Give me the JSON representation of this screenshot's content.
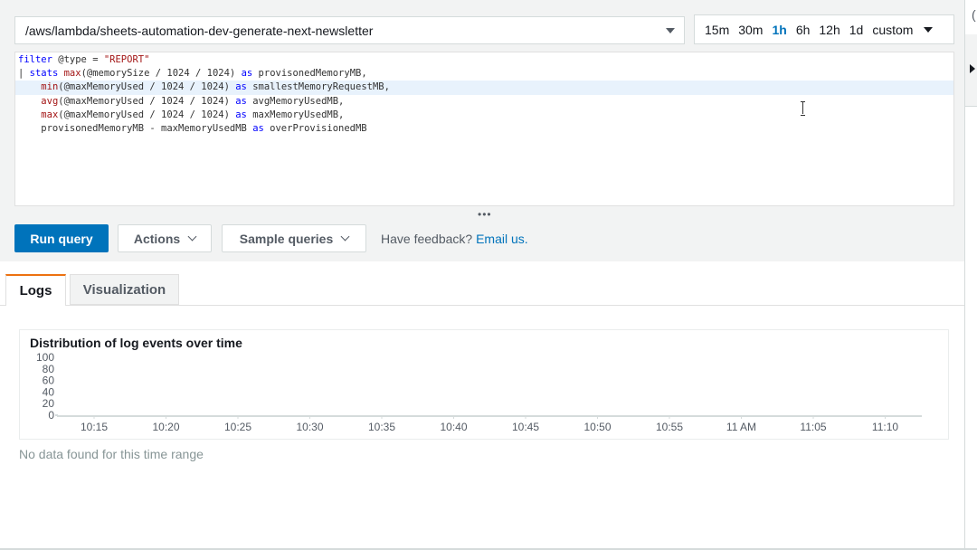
{
  "log_group": {
    "value": "/aws/lambda/sheets-automation-dev-generate-next-newsletter"
  },
  "time_range": {
    "options": [
      "15m",
      "30m",
      "1h",
      "6h",
      "12h",
      "1d",
      "custom"
    ],
    "selected": "1h"
  },
  "query": {
    "lines": [
      [
        {
          "t": "filter",
          "c": "kw"
        },
        {
          "t": " @type = ",
          "c": "var"
        },
        {
          "t": "\"REPORT\"",
          "c": "str"
        }
      ],
      [
        {
          "t": "| ",
          "c": "var"
        },
        {
          "t": "stats",
          "c": "kw"
        },
        {
          "t": " ",
          "c": "var"
        },
        {
          "t": "max",
          "c": "fn"
        },
        {
          "t": "(@memorySize / 1024 / 1024) ",
          "c": "var"
        },
        {
          "t": "as",
          "c": "kw"
        },
        {
          "t": " provisonedMemoryMB,",
          "c": "var"
        }
      ],
      [
        {
          "t": "    ",
          "c": "var"
        },
        {
          "t": "min",
          "c": "fn"
        },
        {
          "t": "(@maxMemoryUsed / 1024 / 1024) ",
          "c": "var"
        },
        {
          "t": "as",
          "c": "kw"
        },
        {
          "t": " smallestMemoryRequestMB,",
          "c": "var"
        }
      ],
      [
        {
          "t": "    ",
          "c": "var"
        },
        {
          "t": "avg",
          "c": "fn"
        },
        {
          "t": "(@maxMemoryUsed / 1024 / 1024) ",
          "c": "var"
        },
        {
          "t": "as",
          "c": "kw"
        },
        {
          "t": " avgMemoryUsedMB,",
          "c": "var"
        }
      ],
      [
        {
          "t": "    ",
          "c": "var"
        },
        {
          "t": "max",
          "c": "fn"
        },
        {
          "t": "(@maxMemoryUsed / 1024 / 1024) ",
          "c": "var"
        },
        {
          "t": "as",
          "c": "kw"
        },
        {
          "t": " maxMemoryUsedMB,",
          "c": "var"
        }
      ],
      [
        {
          "t": "    provisonedMemoryMB - maxMemoryUsedMB ",
          "c": "var"
        },
        {
          "t": "as",
          "c": "kw"
        },
        {
          "t": " overProvisionedMB",
          "c": "var"
        }
      ]
    ],
    "highlighted_line": 2
  },
  "buttons": {
    "run": "Run query",
    "actions": "Actions",
    "samples": "Sample queries"
  },
  "feedback": {
    "text": "Have feedback?",
    "link": "Email us."
  },
  "tabs": {
    "logs": "Logs",
    "visualization": "Visualization"
  },
  "chart_data": {
    "type": "bar",
    "title": "Distribution of log events over time",
    "ylim": [
      0,
      100
    ],
    "y_ticks": [
      "100",
      "80",
      "60",
      "40",
      "20",
      "0"
    ],
    "categories": [
      "10:15",
      "10:20",
      "10:25",
      "10:30",
      "10:35",
      "10:40",
      "10:45",
      "10:50",
      "10:55",
      "11 AM",
      "11:05",
      "11:10"
    ],
    "values": [],
    "grid": false
  },
  "empty_message": "No data found for this time range",
  "colors": {
    "accent": "#0073bb",
    "tab_active": "#ec7211"
  }
}
